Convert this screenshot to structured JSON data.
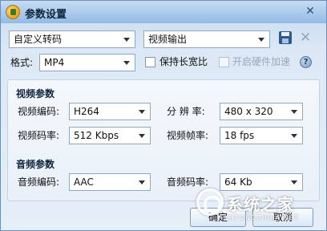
{
  "window": {
    "title": "参数设置",
    "close_glyph": "✕"
  },
  "top": {
    "preset": "自定义转码",
    "output": "视频输出",
    "format_label": "格式:",
    "format_value": "MP4",
    "keep_ratio_label": "保持长宽比",
    "hw_accel_label": "开启硬件加速",
    "help_glyph": "?",
    "delete_glyph": "✕"
  },
  "video": {
    "section_title": "视频参数",
    "codec_label": "视频编码:",
    "codec_value": "H264",
    "resolution_label": "分 辨 率:",
    "resolution_value": "480 x 320",
    "bitrate_label": "视频码率:",
    "bitrate_value": "512 Kbps",
    "fps_label": "视频帧率:",
    "fps_value": "18 fps"
  },
  "audio": {
    "section_title": "音频参数",
    "codec_label": "音频编码:",
    "codec_value": "AAC",
    "bitrate_label": "音频码率:",
    "bitrate_value": "64 Kb"
  },
  "footer": {
    "ok_label": "确定",
    "cancel_label": "取消"
  },
  "watermark": {
    "text": "系统之家",
    "subtext": "XITONGZHIJIA.NET"
  },
  "colors": {
    "titlebar": "#94bbe5",
    "panel": "#eef3fa",
    "border": "#8ea8c8"
  }
}
